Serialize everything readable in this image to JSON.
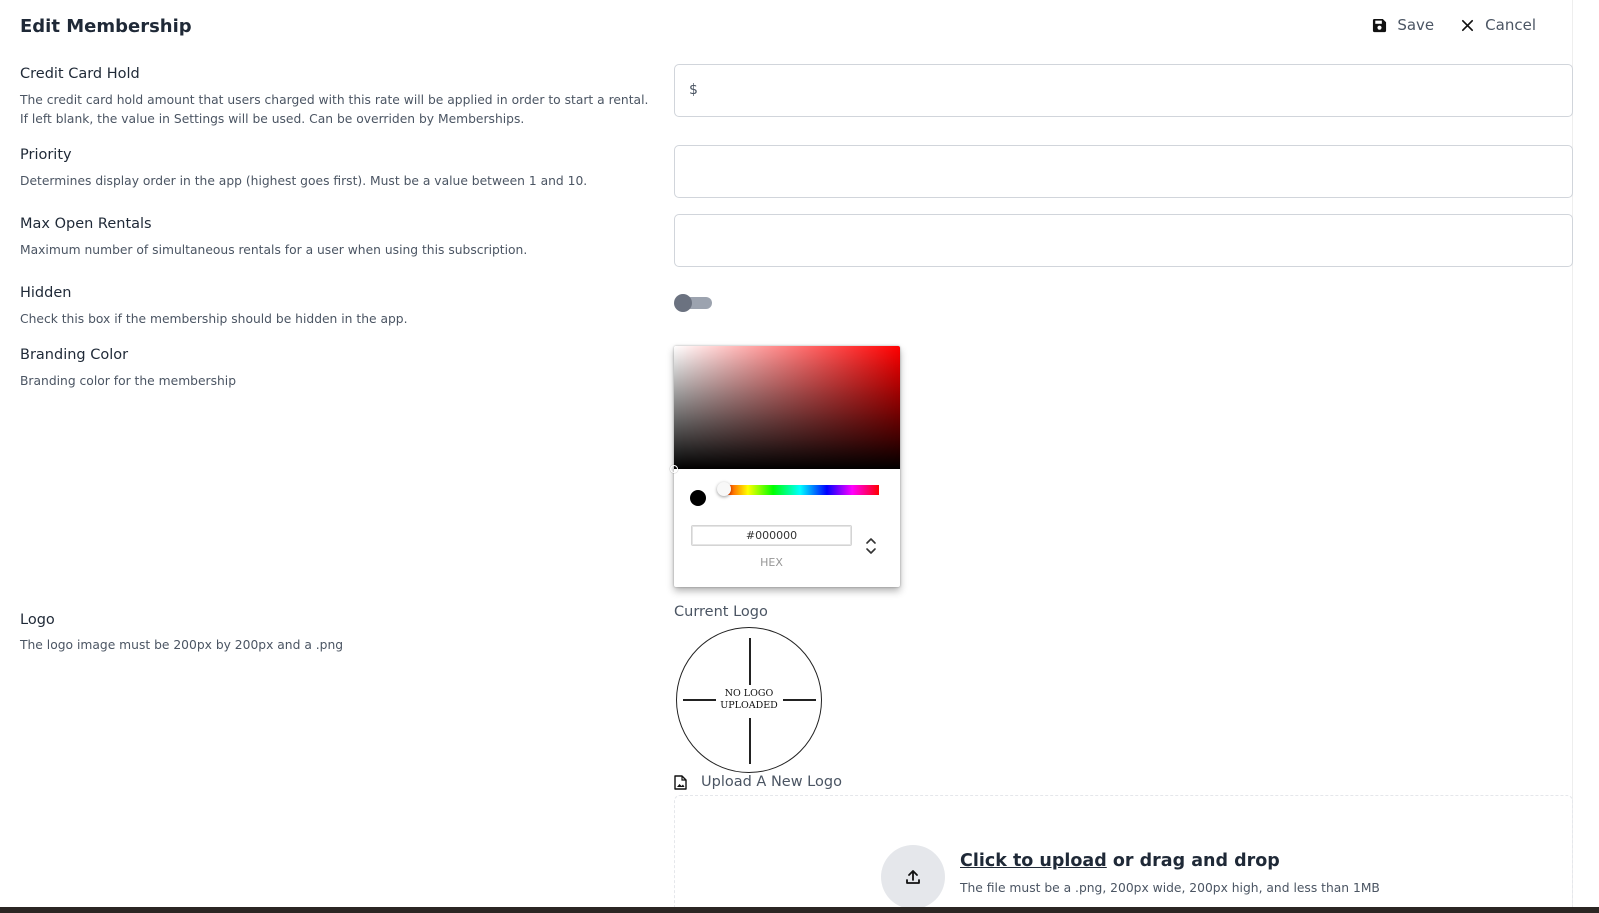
{
  "header": {
    "title": "Edit Membership",
    "save_label": "Save",
    "cancel_label": "Cancel"
  },
  "fields": {
    "credit_card_hold": {
      "label": "Credit Card Hold",
      "description": "The credit card hold amount that users charged with this rate will be applied in order to start a rental. If left blank, the value in Settings will be used. Can be overriden by Memberships.",
      "prefix": "$",
      "value": ""
    },
    "priority": {
      "label": "Priority",
      "description": "Determines display order in the app (highest goes first). Must be a value between 1 and 10.",
      "value": ""
    },
    "max_open_rentals": {
      "label": "Max Open Rentals",
      "description": "Maximum number of simultaneous rentals for a user when using this subscription.",
      "value": ""
    },
    "hidden": {
      "label": "Hidden",
      "description": "Check this box if the membership should be hidden in the app.",
      "checked": false
    },
    "branding_color": {
      "label": "Branding Color",
      "description": "Branding color for the membership",
      "hex_value": "#000000",
      "hex_label": "HEX",
      "hue_color": "#ff0000",
      "selected_color": "#000000"
    },
    "logo": {
      "label": "Logo",
      "description": "The logo image must be 200px by 200px and a .png",
      "current_logo_label": "Current Logo",
      "placeholder_line1": "NO LOGO",
      "placeholder_line2": "UPLOADED",
      "upload_new_label": "Upload A New Logo",
      "click_to_upload": "Click to upload",
      "drag_drop": "or drag and drop",
      "file_hint": "The file must be a .png, 200px wide, 200px high, and less than 1MB"
    }
  },
  "icons": {
    "save": "floppy-disk-icon",
    "cancel": "close-icon",
    "upload_new": "file-image-icon",
    "upload": "upload-arrow-icon",
    "hex_toggle": "chevron-up-down-icon"
  }
}
